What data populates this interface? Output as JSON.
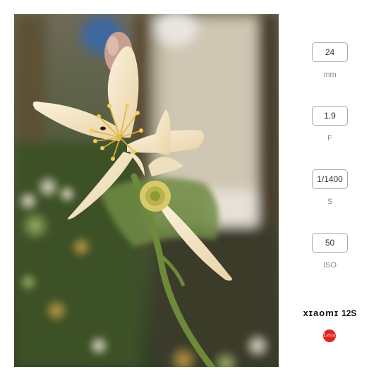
{
  "photo": {
    "icon": "flower-photo"
  },
  "exif": [
    {
      "value": "24",
      "unit": "mm"
    },
    {
      "value": "1.9",
      "unit": "F"
    },
    {
      "value": "1/1400",
      "unit": "S"
    },
    {
      "value": "50",
      "unit": "ISO"
    }
  ],
  "brand": {
    "name": "xɪaomɪ",
    "model": "12S"
  },
  "logo": {
    "text": "Leica",
    "color": "#e2231a"
  }
}
